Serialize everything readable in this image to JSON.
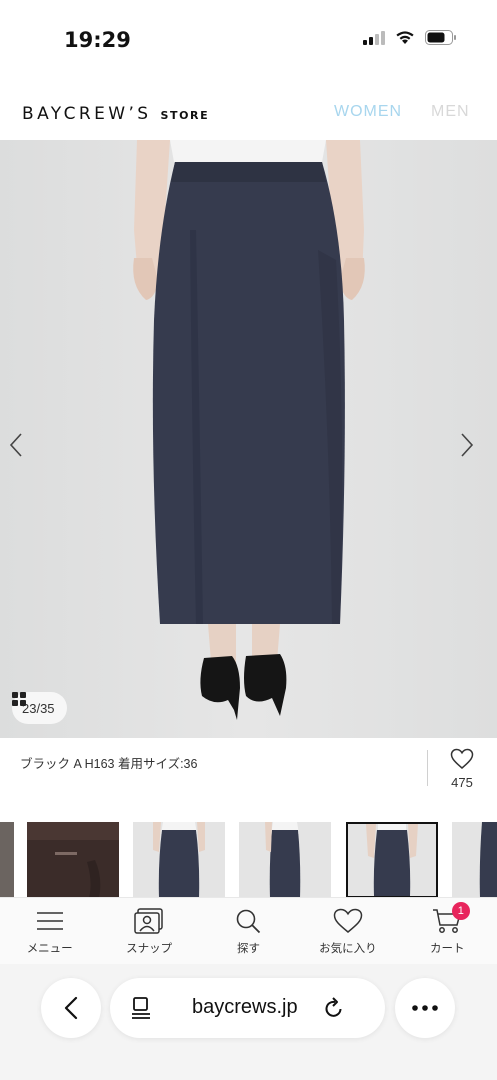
{
  "status_bar": {
    "time": "19:29"
  },
  "header": {
    "logo_main": "BAYCREW’S",
    "logo_sub": "STORE",
    "nav": {
      "women": "WOMEN",
      "men": "MEN"
    },
    "colors": {
      "women": "#a8d6ee",
      "men": "#d8d8d8"
    }
  },
  "gallery": {
    "counter": "23/35",
    "prev_icon": "chevron-left-icon",
    "next_icon": "chevron-right-icon"
  },
  "caption": {
    "text": "ブラック A H163 着用サイズ:36",
    "favorite_count": "475"
  },
  "thumbnails": [
    {
      "name": "thumb-partial",
      "active": false
    },
    {
      "name": "thumb-brown-detail",
      "active": false
    },
    {
      "name": "thumb-navy-front",
      "active": false
    },
    {
      "name": "thumb-navy-side",
      "active": false
    },
    {
      "name": "thumb-navy-back",
      "active": true
    },
    {
      "name": "thumb-navy-partial",
      "active": false
    }
  ],
  "tabbar": {
    "items": [
      {
        "label": "メニュー",
        "icon": "menu-icon"
      },
      {
        "label": "スナップ",
        "icon": "snap-icon"
      },
      {
        "label": "探す",
        "icon": "search-icon"
      },
      {
        "label": "お気に入り",
        "icon": "heart-icon"
      },
      {
        "label": "カート",
        "icon": "cart-icon"
      }
    ],
    "cart_badge": "1",
    "badge_color": "#e8245c"
  },
  "browser": {
    "url": "baycrews.jp"
  }
}
